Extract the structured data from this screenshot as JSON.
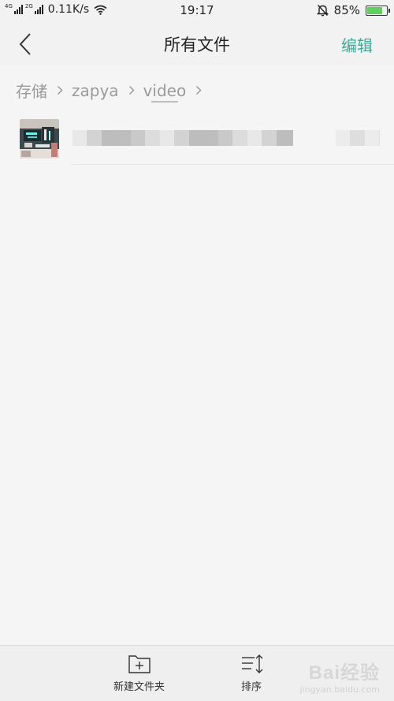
{
  "status_bar": {
    "net1": "4G",
    "net2": "2G",
    "speed": "0.11K/s",
    "time": "19:17",
    "battery_percent": "85%",
    "battery_level": 0.85,
    "icons": [
      "signal-icon",
      "signal-icon",
      "wifi-icon",
      "alarm-off-icon",
      "battery-icon"
    ]
  },
  "header": {
    "title": "所有文件",
    "edit_label": "编辑",
    "accent_color": "#3bac98"
  },
  "breadcrumb": [
    "存储",
    "zapya",
    "video"
  ],
  "files": [
    {
      "name": "",
      "meta": "",
      "thumbnail": "video-thumbnail"
    }
  ],
  "toolbar": {
    "new_folder_label": "新建文件夹",
    "sort_label": "排序"
  },
  "watermark": {
    "main": "Bai经验",
    "sub": "jingyan.baidu.com"
  }
}
